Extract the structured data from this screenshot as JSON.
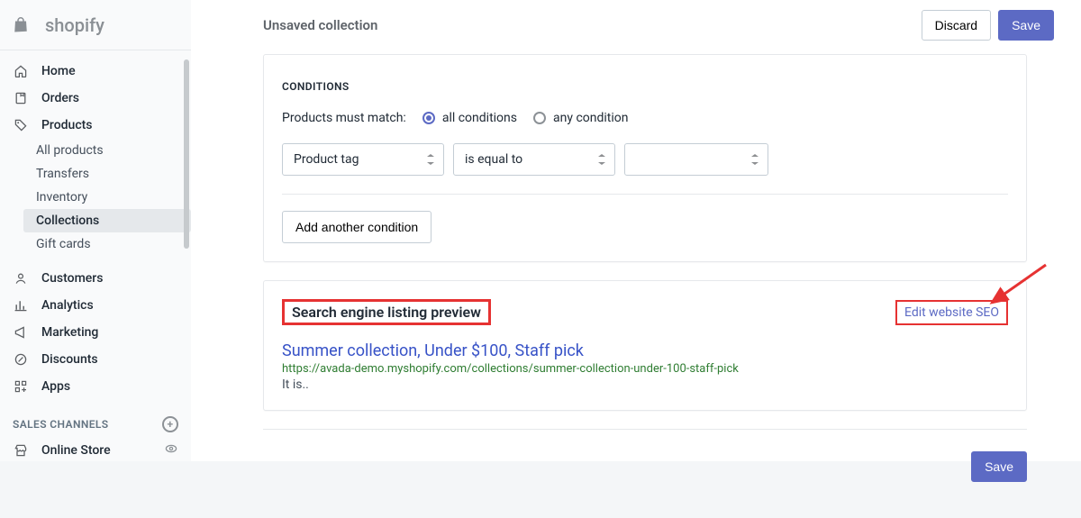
{
  "brand": "shopify",
  "header": {
    "title": "Unsaved collection",
    "discard": "Discard",
    "save": "Save"
  },
  "nav": {
    "home": "Home",
    "orders": "Orders",
    "products": "Products",
    "products_sub": {
      "all": "All products",
      "transfers": "Transfers",
      "inventory": "Inventory",
      "collections": "Collections",
      "gift_cards": "Gift cards"
    },
    "customers": "Customers",
    "analytics": "Analytics",
    "marketing": "Marketing",
    "discounts": "Discounts",
    "apps": "Apps",
    "sales_channels_label": "SALES CHANNELS",
    "online_store": "Online Store"
  },
  "conditions": {
    "title": "CONDITIONS",
    "match_label": "Products must match:",
    "all": "all conditions",
    "any": "any condition",
    "field": "Product tag",
    "operator": "is equal to",
    "value": "",
    "add": "Add another condition"
  },
  "seo": {
    "title": "Search engine listing preview",
    "edit_link": "Edit website SEO",
    "result_title": "Summer collection, Under $100, Staff pick",
    "result_url": "https://avada-demo.myshopify.com/collections/summer-collection-under-100-staff-pick",
    "result_desc": "It is.."
  },
  "footer": {
    "save": "Save"
  }
}
